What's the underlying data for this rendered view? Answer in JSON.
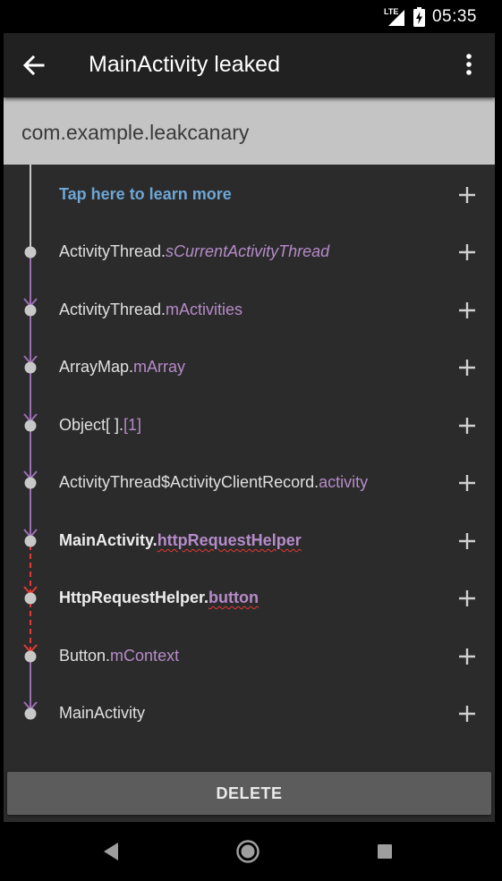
{
  "status_bar": {
    "network": "LTE",
    "time": "05:35"
  },
  "toolbar": {
    "title": "MainActivity leaked",
    "back_icon": "arrow-back-icon",
    "overflow_icon": "more-vert-icon"
  },
  "package": {
    "name": "com.example.leakcanary"
  },
  "learn_more": {
    "label": "Tap here to learn more"
  },
  "trace": [
    {
      "cls": "ActivityThread.",
      "field": "sCurrentActivityThread"
    },
    {
      "cls": "ActivityThread.",
      "field": "mActivities"
    },
    {
      "cls": "ArrayMap.",
      "field": "mArray"
    },
    {
      "cls": "Object[ ].",
      "field": "[1]"
    },
    {
      "cls": "ActivityThread$ActivityClientRecord.",
      "field": "activity"
    },
    {
      "cls": "MainActivity.",
      "field": "httpRequestHelper"
    },
    {
      "cls": "HttpRequestHelper.",
      "field": "button"
    },
    {
      "cls": "Button.",
      "field": "mContext"
    },
    {
      "cls": "MainActivity",
      "field": ""
    }
  ],
  "actions": {
    "delete_label": "DELETE"
  },
  "colors": {
    "accent_field": "#b68bc9",
    "link": "#6ea6d6",
    "suspect_line": "#e53935",
    "trace_line": "#9c6fb5"
  },
  "nav": {
    "back_icon": "nav-back-icon",
    "home_icon": "nav-home-icon",
    "recents_icon": "nav-recents-icon"
  }
}
